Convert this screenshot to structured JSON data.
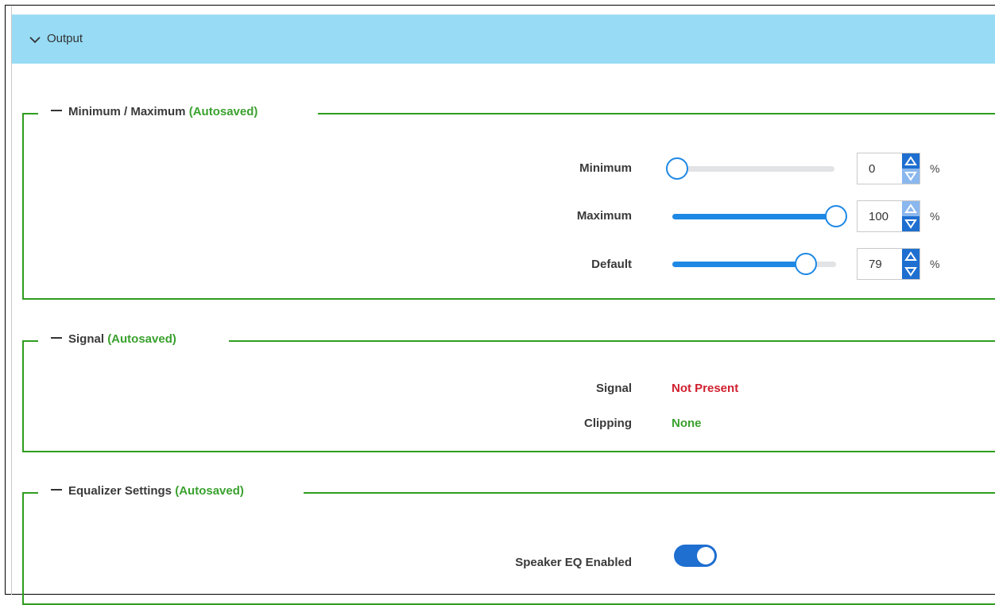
{
  "panel": {
    "title": "Output"
  },
  "minmax": {
    "legend": "Minimum / Maximum",
    "autosaved": "(Autosaved)",
    "rows": [
      {
        "label": "Minimum",
        "value": "0",
        "percent_value": 0,
        "unit": "%",
        "up_enabled": true,
        "down_enabled": false
      },
      {
        "label": "Maximum",
        "value": "100",
        "percent_value": 100,
        "unit": "%",
        "up_enabled": false,
        "down_enabled": true
      },
      {
        "label": "Default",
        "value": "79",
        "percent_value": 79,
        "unit": "%",
        "up_enabled": true,
        "down_enabled": true
      }
    ]
  },
  "signal": {
    "legend": "Signal",
    "autosaved": "(Autosaved)",
    "signal_label": "Signal",
    "signal_value": "Not Present",
    "clipping_label": "Clipping",
    "clipping_value": "None"
  },
  "equalizer": {
    "legend": "Equalizer Settings",
    "autosaved": "(Autosaved)",
    "speaker_eq_label": "Speaker EQ Enabled",
    "speaker_eq_enabled": true
  },
  "colors": {
    "header_bg": "#97dbf5",
    "group_border": "#2f9d1f",
    "accent": "#1e88e5",
    "not_present": "#d0202e",
    "none": "#3aa12e"
  },
  "icons": {
    "panel_toggle": "chevron-down-icon",
    "spin_up": "triangle-up-icon",
    "spin_down": "triangle-down-icon"
  }
}
